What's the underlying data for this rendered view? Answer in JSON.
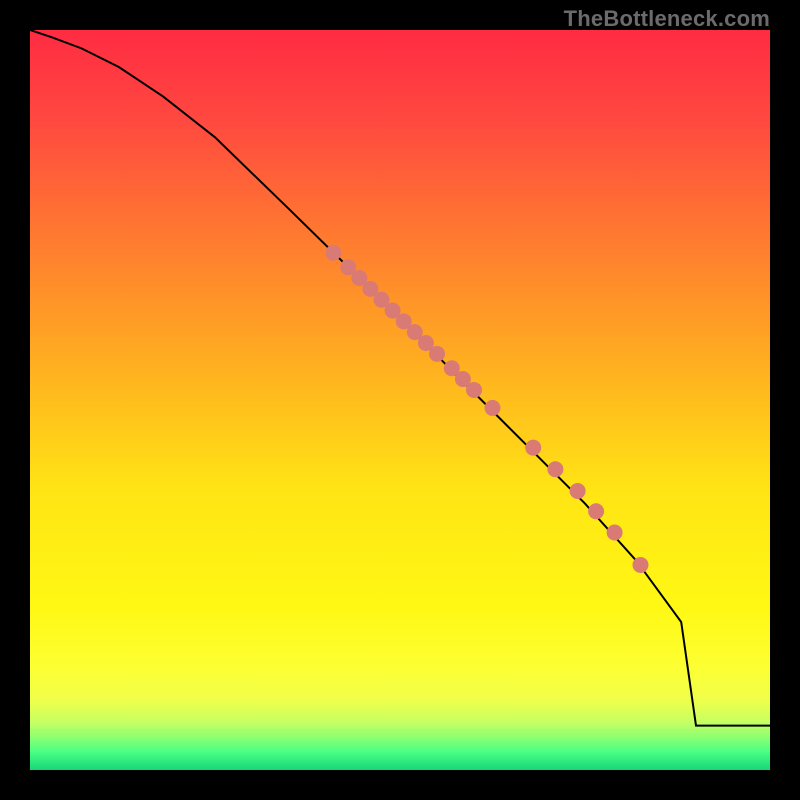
{
  "watermark": "TheBottleneck.com",
  "colors": {
    "marker_fill": "#d97b74",
    "marker_stroke": "#c46862",
    "curve_stroke": "#000000"
  },
  "gradient_stops": [
    {
      "offset": 0.0,
      "color": "#ff2b42"
    },
    {
      "offset": 0.12,
      "color": "#ff4840"
    },
    {
      "offset": 0.28,
      "color": "#ff7a30"
    },
    {
      "offset": 0.45,
      "color": "#ffae20"
    },
    {
      "offset": 0.62,
      "color": "#ffe414"
    },
    {
      "offset": 0.78,
      "color": "#fff814"
    },
    {
      "offset": 0.86,
      "color": "#fdff32"
    },
    {
      "offset": 0.905,
      "color": "#f0ff4a"
    },
    {
      "offset": 0.935,
      "color": "#c7ff62"
    },
    {
      "offset": 0.955,
      "color": "#8fff70"
    },
    {
      "offset": 0.975,
      "color": "#4bff84"
    },
    {
      "offset": 1.0,
      "color": "#17d67a"
    }
  ],
  "chart_data": {
    "type": "line",
    "title": "",
    "xlabel": "",
    "ylabel": "",
    "xlim": [
      0,
      100
    ],
    "ylim": [
      0,
      100
    ],
    "grid": false,
    "curve": {
      "x": [
        0,
        3,
        7,
        12,
        18,
        25,
        35,
        45,
        55,
        65,
        75,
        82,
        88,
        90,
        100
      ],
      "y": [
        100,
        99,
        97.5,
        95,
        91,
        85.5,
        75.8,
        66,
        56,
        46,
        36,
        28.2,
        20,
        6,
        6
      ]
    },
    "markers": {
      "x": [
        41,
        43,
        44.5,
        46,
        47.5,
        49,
        50.5,
        52,
        53.5,
        55,
        57,
        58.5,
        60,
        62.5,
        68,
        71,
        74,
        76.5,
        79,
        82.5
      ],
      "y": [
        69.9,
        67.95,
        66.49,
        65.02,
        63.56,
        62.1,
        60.63,
        59.17,
        57.7,
        56.24,
        54.29,
        52.83,
        51.36,
        48.93,
        43.56,
        40.64,
        37.71,
        34.96,
        32.09,
        27.71
      ]
    }
  }
}
